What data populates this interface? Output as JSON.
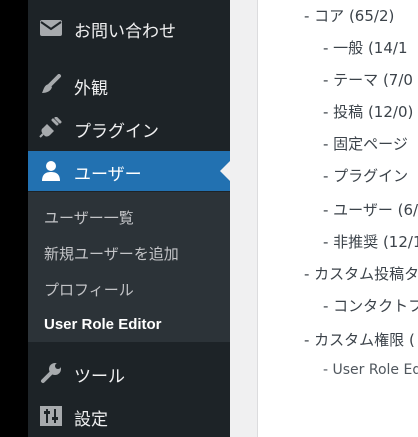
{
  "sidebar": {
    "items": [
      {
        "label": "お問い合わせ",
        "icon": "envelope-icon"
      },
      {
        "label": "外観",
        "icon": "paintbrush-icon"
      },
      {
        "label": "プラグイン",
        "icon": "plug-icon"
      },
      {
        "label": "ユーザー",
        "icon": "user-icon"
      },
      {
        "label": "ツール",
        "icon": "wrench-icon"
      },
      {
        "label": "設定",
        "icon": "sliders-icon"
      }
    ],
    "submenu": [
      {
        "label": "ユーザー一覧"
      },
      {
        "label": "新規ユーザーを追加"
      },
      {
        "label": "プロフィール"
      },
      {
        "label": "User Role Editor"
      }
    ]
  },
  "tree": [
    {
      "label": "- コア (65/2)"
    },
    {
      "label": "- 一般 (14/1"
    },
    {
      "label": "- テーマ (7/0"
    },
    {
      "label": "- 投稿 (12/0)"
    },
    {
      "label": "- 固定ページ"
    },
    {
      "label": "- プラグイン"
    },
    {
      "label": "- ユーザー (6/"
    },
    {
      "label": "- 非推奨 (12/1"
    },
    {
      "label": "- カスタム投稿タ"
    },
    {
      "label": "- コンタクトフ"
    },
    {
      "label": "- カスタム権限 ("
    },
    {
      "label": "- User Role Ed"
    }
  ],
  "colors": {
    "menu_bg": "#1d2327",
    "submenu_bg": "#2c3338",
    "current_bg": "#2271b1",
    "content_bg": "#ffffff"
  }
}
